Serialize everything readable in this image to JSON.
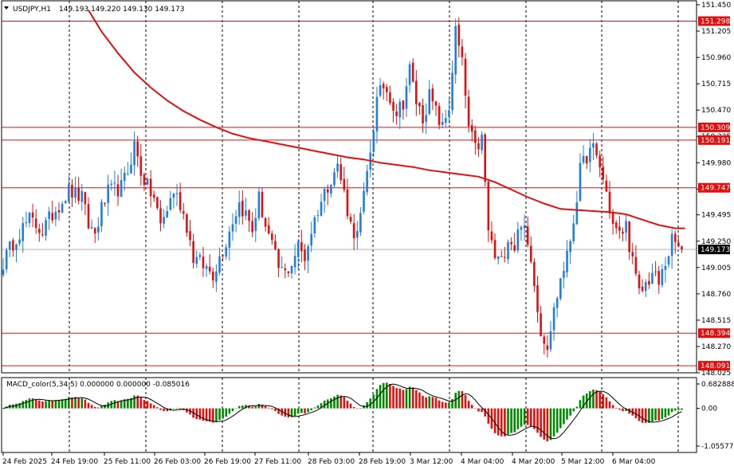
{
  "header": {
    "symbol": "USDJPY,H1",
    "ohlc": "149.193 149.220 149.130 149.173",
    "menu_icon": "triangle-down-icon"
  },
  "macd_header": {
    "label": "MACD_color(5,34,5) 0.000000 0.000000 -0.085016"
  },
  "colors": {
    "background": "#ffffff",
    "bull": "#1e7fe0",
    "bear": "#e01010",
    "ma": "#e01010",
    "level": "#e01010",
    "grid": "#000000",
    "macd_pos": "#008a00",
    "macd_neg": "#e01010",
    "signal": "#000000",
    "current_badge": "#000000",
    "level_badge": "#e01010"
  },
  "chart_data": [
    {
      "type": "candlestick",
      "title": "USDJPY,H1",
      "ylim": [
        148.025,
        151.45
      ],
      "y_ticks": [
        "151.450",
        "151.205",
        "150.960",
        "150.715",
        "150.470",
        "150.225",
        "149.980",
        "149.735",
        "149.495",
        "149.250",
        "149.005",
        "148.760",
        "148.515",
        "148.270",
        "148.025"
      ],
      "x_tick_labels": [
        "24 Feb 2025",
        "24 Feb 19:00",
        "25 Feb 11:00",
        "26 Feb 03:00",
        "26 Feb 19:00",
        "27 Feb 11:00",
        "28 Feb 03:00",
        "28 Feb 19:00",
        "3 Mar 12:00",
        "4 Mar 04:00",
        "4 Mar 20:00",
        "5 Mar 12:00",
        "6 Mar 04:00"
      ],
      "grid": "vertical dotted",
      "current_price": "149.173",
      "levels": [
        {
          "label": "151.298",
          "value": 151.298
        },
        {
          "label": "150.309",
          "value": 150.309
        },
        {
          "label": "150.191",
          "value": 150.191
        },
        {
          "label": "149.747",
          "value": 149.747
        },
        {
          "label": "148.394",
          "value": 148.394
        },
        {
          "label": "148.091",
          "value": 148.091
        }
      ],
      "close_path": [
        [
          0,
          149.05
        ],
        [
          4,
          149.3
        ],
        [
          8,
          149.45
        ],
        [
          12,
          149.35
        ],
        [
          16,
          149.55
        ],
        [
          20,
          149.72
        ],
        [
          24,
          149.65
        ],
        [
          26,
          149.4
        ],
        [
          28,
          149.32
        ],
        [
          30,
          149.55
        ],
        [
          32,
          149.7
        ],
        [
          36,
          149.75
        ],
        [
          38,
          149.9
        ],
        [
          40,
          150.15
        ],
        [
          42,
          149.9
        ],
        [
          44,
          149.75
        ],
        [
          46,
          149.65
        ],
        [
          48,
          149.4
        ],
        [
          50,
          149.55
        ],
        [
          52,
          149.72
        ],
        [
          54,
          149.6
        ],
        [
          56,
          149.4
        ],
        [
          58,
          149.1
        ],
        [
          60,
          149.05
        ],
        [
          62,
          149.0
        ],
        [
          64,
          148.95
        ],
        [
          66,
          149.1
        ],
        [
          68,
          149.25
        ],
        [
          70,
          149.45
        ],
        [
          72,
          149.6
        ],
        [
          74,
          149.5
        ],
        [
          76,
          149.35
        ],
        [
          78,
          149.65
        ],
        [
          80,
          149.4
        ],
        [
          82,
          149.2
        ],
        [
          84,
          149.0
        ],
        [
          86,
          148.95
        ],
        [
          88,
          149.05
        ],
        [
          90,
          149.2
        ],
        [
          92,
          149.1
        ],
        [
          94,
          149.35
        ],
        [
          96,
          149.55
        ],
        [
          98,
          149.7
        ],
        [
          100,
          149.85
        ],
        [
          102,
          149.95
        ],
        [
          104,
          149.7
        ],
        [
          106,
          149.4
        ],
        [
          108,
          149.3
        ],
        [
          110,
          149.65
        ],
        [
          112,
          150.1
        ],
        [
          114,
          150.55
        ],
        [
          116,
          150.7
        ],
        [
          118,
          150.6
        ],
        [
          120,
          150.45
        ],
        [
          122,
          150.55
        ],
        [
          124,
          150.85
        ],
        [
          126,
          150.55
        ],
        [
          128,
          150.4
        ],
        [
          130,
          150.6
        ],
        [
          132,
          150.45
        ],
        [
          134,
          150.3
        ],
        [
          136,
          150.5
        ],
        [
          138,
          151.2
        ],
        [
          140,
          150.9
        ],
        [
          142,
          150.3
        ],
        [
          144,
          150.1
        ],
        [
          146,
          150.2
        ],
        [
          148,
          149.35
        ],
        [
          150,
          149.1
        ],
        [
          152,
          149.05
        ],
        [
          154,
          149.3
        ],
        [
          156,
          149.2
        ],
        [
          158,
          149.45
        ],
        [
          160,
          149.2
        ],
        [
          162,
          148.9
        ],
        [
          164,
          148.4
        ],
        [
          166,
          148.3
        ],
        [
          168,
          148.6
        ],
        [
          170,
          148.9
        ],
        [
          172,
          149.1
        ],
        [
          174,
          149.45
        ],
        [
          176,
          149.9
        ],
        [
          178,
          150.05
        ],
        [
          180,
          150.1
        ],
        [
          182,
          149.95
        ],
        [
          184,
          149.7
        ],
        [
          186,
          149.4
        ],
        [
          188,
          149.3
        ],
        [
          190,
          149.4
        ],
        [
          192,
          149.05
        ],
        [
          194,
          148.75
        ],
        [
          196,
          148.85
        ],
        [
          198,
          148.95
        ],
        [
          200,
          148.85
        ],
        [
          202,
          149.05
        ],
        [
          204,
          149.25
        ],
        [
          206,
          149.2
        ],
        [
          207,
          149.173
        ]
      ],
      "ma_path": [
        [
          26,
          151.4
        ],
        [
          30,
          151.2
        ],
        [
          35,
          151.0
        ],
        [
          40,
          150.82
        ],
        [
          45,
          150.68
        ],
        [
          50,
          150.56
        ],
        [
          55,
          150.46
        ],
        [
          60,
          150.38
        ],
        [
          65,
          150.31
        ],
        [
          70,
          150.25
        ],
        [
          75,
          150.21
        ],
        [
          80,
          150.18
        ],
        [
          85,
          150.15
        ],
        [
          90,
          150.12
        ],
        [
          95,
          150.09
        ],
        [
          100,
          150.06
        ],
        [
          105,
          150.03
        ],
        [
          110,
          150.01
        ],
        [
          115,
          149.98
        ],
        [
          120,
          149.96
        ],
        [
          125,
          149.94
        ],
        [
          130,
          149.91
        ],
        [
          135,
          149.89
        ],
        [
          140,
          149.87
        ],
        [
          145,
          149.85
        ],
        [
          150,
          149.8
        ],
        [
          155,
          149.73
        ],
        [
          160,
          149.66
        ],
        [
          165,
          149.6
        ],
        [
          170,
          149.55
        ],
        [
          175,
          149.54
        ],
        [
          180,
          149.53
        ],
        [
          185,
          149.52
        ],
        [
          190,
          149.5
        ],
        [
          195,
          149.45
        ],
        [
          200,
          149.4
        ],
        [
          205,
          149.37
        ],
        [
          208,
          149.37
        ]
      ]
    },
    {
      "type": "bar",
      "title": "MACD_color(5,34,5)",
      "ylim": [
        -1.055775,
        0.682888
      ],
      "y_ticks": [
        "0.682888",
        "0.00",
        "-1.055775"
      ],
      "series": [
        {
          "name": "MACD",
          "values_by_bar": "computed from EMA5 - EMA34 of close"
        },
        {
          "name": "Signal",
          "values_by_bar": "SMA5 of MACD"
        }
      ]
    }
  ]
}
